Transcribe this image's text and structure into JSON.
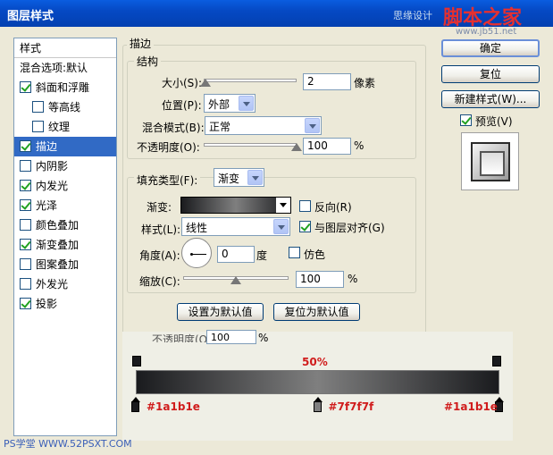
{
  "window": {
    "title": "图层样式",
    "watermark_left": "思缘设计",
    "watermark_right": "脚本之家",
    "watermark_url": "www.jb51.net",
    "footer_watermark": "PS学堂 WWW.52PSXT.COM"
  },
  "sidebar": {
    "header": "样式",
    "items": [
      {
        "label": "混合选项:默认",
        "checkbox": false,
        "checked": false,
        "indent": false,
        "selected": false
      },
      {
        "label": "斜面和浮雕",
        "checkbox": true,
        "checked": true,
        "indent": false,
        "selected": false
      },
      {
        "label": "等高线",
        "checkbox": true,
        "checked": false,
        "indent": true,
        "selected": false
      },
      {
        "label": "纹理",
        "checkbox": true,
        "checked": false,
        "indent": true,
        "selected": false
      },
      {
        "label": "描边",
        "checkbox": true,
        "checked": true,
        "indent": false,
        "selected": true
      },
      {
        "label": "内阴影",
        "checkbox": true,
        "checked": false,
        "indent": false,
        "selected": false
      },
      {
        "label": "内发光",
        "checkbox": true,
        "checked": true,
        "indent": false,
        "selected": false
      },
      {
        "label": "光泽",
        "checkbox": true,
        "checked": true,
        "indent": false,
        "selected": false
      },
      {
        "label": "颜色叠加",
        "checkbox": true,
        "checked": false,
        "indent": false,
        "selected": false
      },
      {
        "label": "渐变叠加",
        "checkbox": true,
        "checked": true,
        "indent": false,
        "selected": false
      },
      {
        "label": "图案叠加",
        "checkbox": true,
        "checked": false,
        "indent": false,
        "selected": false
      },
      {
        "label": "外发光",
        "checkbox": true,
        "checked": false,
        "indent": false,
        "selected": false
      },
      {
        "label": "投影",
        "checkbox": true,
        "checked": true,
        "indent": false,
        "selected": false
      }
    ]
  },
  "stroke": {
    "section_title": "描边",
    "structure_title": "结构",
    "size_label": "大小(S):",
    "size_value": "2",
    "size_unit": "像素",
    "size_slider": 0.02,
    "position_label": "位置(P):",
    "position_value": "外部",
    "blend_label": "混合模式(B):",
    "blend_value": "正常",
    "opacity_label": "不透明度(O):",
    "opacity_value": "100",
    "opacity_unit": "%",
    "opacity_slider": 1.0,
    "fill_type_label": "填充类型(F):",
    "fill_type_value": "渐变",
    "gradient_label": "渐变:",
    "reverse_label": "反向(R)",
    "reverse_checked": false,
    "style_label": "样式(L):",
    "style_value": "线性",
    "align_label": "与图层对齐(G)",
    "align_checked": true,
    "angle_label": "角度(A):",
    "angle_value": "0",
    "angle_unit": "度",
    "dither_label": "仿色",
    "dither_checked": false,
    "scale_label": "缩放(C):",
    "scale_value": "100",
    "scale_unit": "%",
    "scale_slider": 0.5,
    "make_default_label": "设置为默认值",
    "reset_default_label": "复位为默认值"
  },
  "buttons": {
    "ok": "确定",
    "reset": "复位",
    "new_style": "新建样式(W)...",
    "preview_label": "预览(V)",
    "preview_checked": true
  },
  "gradient_editor": {
    "partial_label": "不透明度(O):",
    "partial_value": "100",
    "partial_unit": "%",
    "midpoint_label": "50%",
    "stops": [
      {
        "color": "#1a1b1e",
        "label": "#1a1b1e",
        "location": 0
      },
      {
        "color": "#7f7f7f",
        "label": "#7f7f7f",
        "location": 50
      },
      {
        "color": "#1a1b1e",
        "label": "#1a1b1e",
        "location": 100
      }
    ]
  }
}
